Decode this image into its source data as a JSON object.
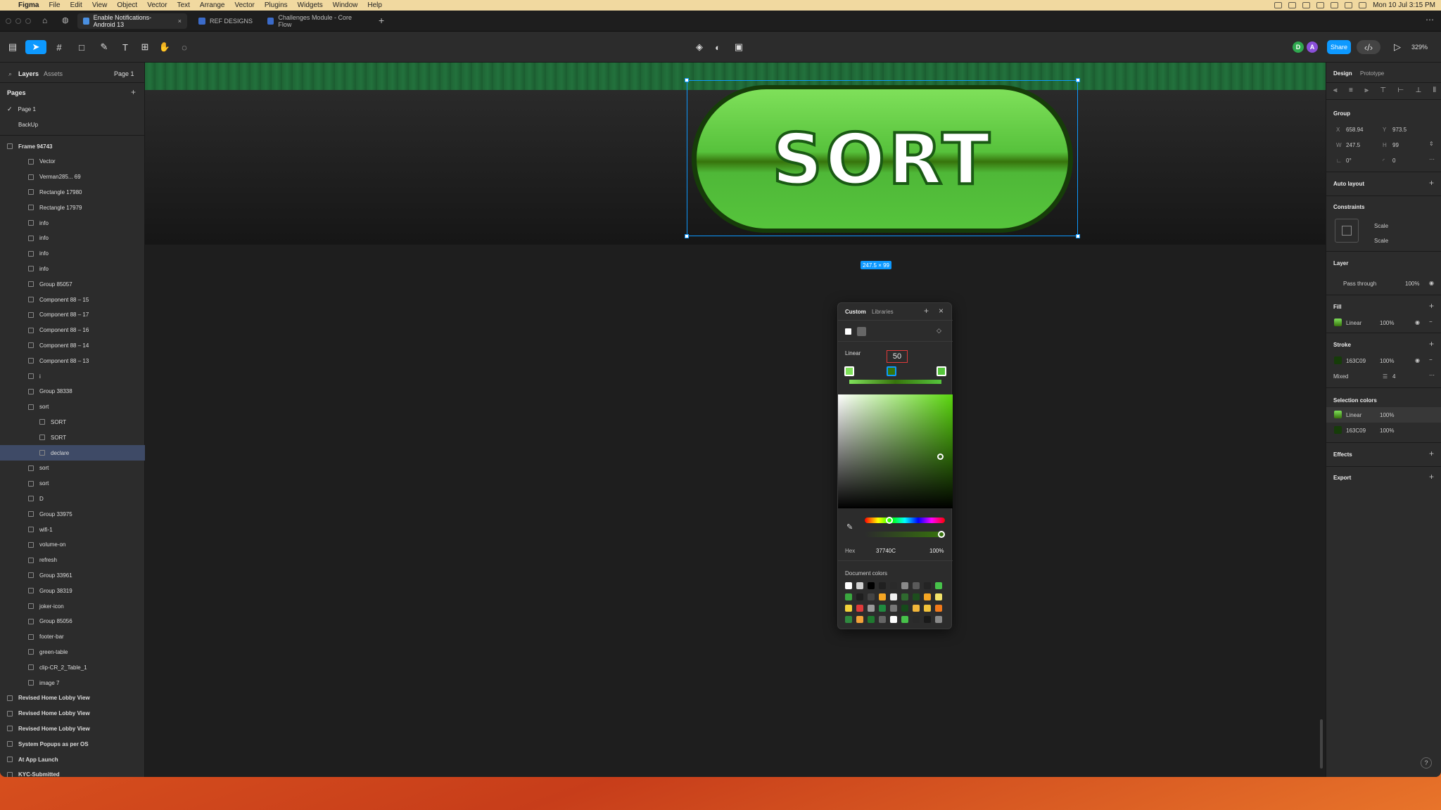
{
  "menubar": {
    "app": "Figma",
    "items": [
      "File",
      "Edit",
      "View",
      "Object",
      "Vector",
      "Text",
      "Arrange",
      "Vector",
      "Plugins",
      "Widgets",
      "Window",
      "Help"
    ],
    "clock": "Mon 10 Jul 3:15 PM"
  },
  "tabs": [
    {
      "label": "Enable Notifications-Android 13",
      "active": true
    },
    {
      "label": "REF DESIGNS",
      "active": false
    },
    {
      "label": "Challenges Module - Core Flow",
      "active": false
    }
  ],
  "toolbar": {
    "share": "Share",
    "zoom": "329%",
    "avatars": [
      {
        "letter": "D",
        "color": "#2fa84f"
      },
      {
        "letter": "A",
        "color": "#8a4fd8"
      }
    ]
  },
  "left": {
    "tab_layers": "Layers",
    "tab_assets": "Assets",
    "page_selector": "Page 1",
    "pages_header": "Pages",
    "pages": [
      "Page 1",
      "BackUp"
    ],
    "layers": [
      {
        "label": "Frame 94743",
        "indent": 0,
        "top": true
      },
      {
        "label": "Vector",
        "indent": 1
      },
      {
        "label": "Verman285... 69",
        "indent": 1
      },
      {
        "label": "Rectangle 17980",
        "indent": 1
      },
      {
        "label": "Rectangle 17979",
        "indent": 1
      },
      {
        "label": "info",
        "indent": 1
      },
      {
        "label": "info",
        "indent": 1
      },
      {
        "label": "info",
        "indent": 1
      },
      {
        "label": "info",
        "indent": 1
      },
      {
        "label": "Group 85057",
        "indent": 1
      },
      {
        "label": "Component 88 – 15",
        "indent": 1
      },
      {
        "label": "Component 88 – 17",
        "indent": 1
      },
      {
        "label": "Component 88 – 16",
        "indent": 1
      },
      {
        "label": "Component 88 – 14",
        "indent": 1
      },
      {
        "label": "Component 88 – 13",
        "indent": 1
      },
      {
        "label": "i",
        "indent": 1
      },
      {
        "label": "Group 38338",
        "indent": 1
      },
      {
        "label": "sort",
        "indent": 1
      },
      {
        "label": "SORT",
        "indent": 2
      },
      {
        "label": "SORT",
        "indent": 2
      },
      {
        "label": "declare",
        "indent": 2,
        "selected": true
      },
      {
        "label": "sort",
        "indent": 1
      },
      {
        "label": "sort",
        "indent": 1
      },
      {
        "label": "D",
        "indent": 1
      },
      {
        "label": "Group 33975",
        "indent": 1
      },
      {
        "label": "wifi-1",
        "indent": 1
      },
      {
        "label": "volume-on",
        "indent": 1
      },
      {
        "label": "refresh",
        "indent": 1
      },
      {
        "label": "Group 33961",
        "indent": 1
      },
      {
        "label": "Group 38319",
        "indent": 1
      },
      {
        "label": "joker-icon",
        "indent": 1
      },
      {
        "label": "Group 85056",
        "indent": 1
      },
      {
        "label": "footer-bar",
        "indent": 1
      },
      {
        "label": "green-table",
        "indent": 1
      },
      {
        "label": "clip-CR_2_Table_1",
        "indent": 1
      },
      {
        "label": "image 7",
        "indent": 1
      },
      {
        "label": "Revised Home Lobby View",
        "indent": 0,
        "top": true
      },
      {
        "label": "Revised Home Lobby View",
        "indent": 0,
        "top": true
      },
      {
        "label": "Revised Home Lobby View",
        "indent": 0,
        "top": true
      },
      {
        "label": "System Popups as per OS",
        "indent": 0,
        "top": true
      },
      {
        "label": "At App Launch",
        "indent": 0,
        "top": true
      },
      {
        "label": "KYC-Submitted",
        "indent": 0,
        "top": true
      }
    ]
  },
  "canvas": {
    "button_text": "SORT",
    "size_badge": "247.5 × 99"
  },
  "picker": {
    "tab_custom": "Custom",
    "tab_libraries": "Libraries",
    "type": "Linear",
    "stop_position": "50",
    "hex_label": "Hex",
    "hex": "37740C",
    "opacity": "100%",
    "doc_colors_label": "Document colors",
    "doc_colors": [
      "#ffffff",
      "#cfcfcf",
      "#000000",
      "#202020",
      "#2a2a2a",
      "#8a8a8a",
      "#5a5a5a",
      "#242424",
      "#47c24a",
      "#3aa83f",
      "#1e1e1e",
      "#444444",
      "#f5a623",
      "#f0f0f0",
      "#2f6a2f",
      "#1d4d1d",
      "#f5a623",
      "#f3e36a",
      "#f3d23a",
      "#e03a3a",
      "#9a9a9a",
      "#1f8a3f",
      "#777777",
      "#164a1a",
      "#f2b63a",
      "#f2c23a",
      "#f27a1a",
      "#2f8a3f",
      "#f2a23a",
      "#1f7a2f",
      "#666666",
      "#ffffff",
      "#47c24a",
      "#2a2a2a",
      "#1a1a1a",
      "#8a8a8a"
    ]
  },
  "right": {
    "tab_design": "Design",
    "tab_prototype": "Prototype",
    "group": "Group",
    "x_label": "X",
    "x": "658.94",
    "y_label": "Y",
    "y": "973.5",
    "w_label": "W",
    "w": "247.5",
    "h_label": "H",
    "h": "99",
    "rot": "0°",
    "radius": "0",
    "auto_layout": "Auto layout",
    "constraints": "Constraints",
    "scale_h": "Scale",
    "scale_v": "Scale",
    "layer": "Layer",
    "blend": "Pass through",
    "layer_opacity": "100%",
    "fill": "Fill",
    "fill_type": "Linear",
    "fill_opacity": "100%",
    "stroke": "Stroke",
    "stroke_color": "163C09",
    "stroke_opacity": "100%",
    "stroke_pos": "Mixed",
    "stroke_weight": "4",
    "selection_colors": "Selection colors",
    "sel_color1": "Linear",
    "sel_color1_opacity": "100%",
    "sel_color2": "163C09",
    "sel_color2_opacity": "100%",
    "effects": "Effects",
    "export": "Export",
    "help": "?"
  },
  "colors": {
    "accent": "#0d99ff",
    "green": "#4fbf3a",
    "dark_green": "#163C09"
  }
}
